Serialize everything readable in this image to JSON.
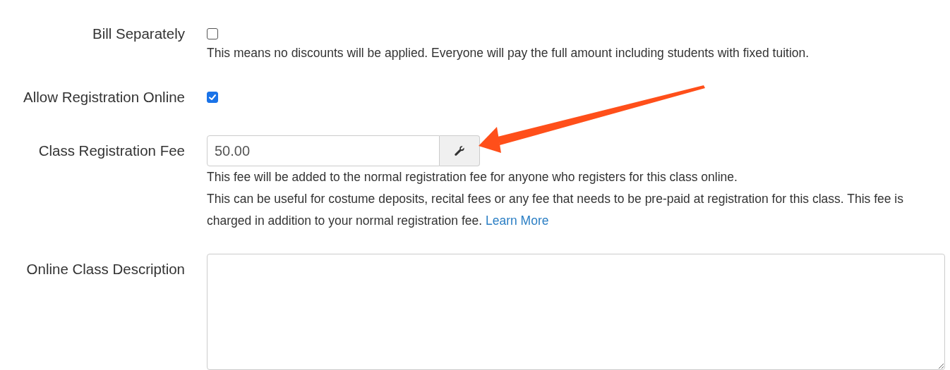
{
  "fields": [
    {
      "kind": "checkbox",
      "label": "Bill Separately",
      "checked": false,
      "help": [
        {
          "text": "This means no discounts will be applied. Everyone will pay the full amount including students with fixed tuition."
        }
      ]
    },
    {
      "kind": "checkbox",
      "label": "Allow Registration Online",
      "checked": true
    },
    {
      "kind": "input_button",
      "label": "Class Registration Fee",
      "value": "50.00",
      "help": [
        {
          "text": "This fee will be added to the normal registration fee for anyone who registers for this class online."
        },
        {
          "text": "This can be useful for costume deposits, recital fees or any fee that needs to be pre-paid at registration for this class. This fee is charged in addition to your normal registration fee.",
          "link": "Learn More"
        }
      ]
    },
    {
      "kind": "textarea",
      "label": "Online Class Description"
    }
  ]
}
